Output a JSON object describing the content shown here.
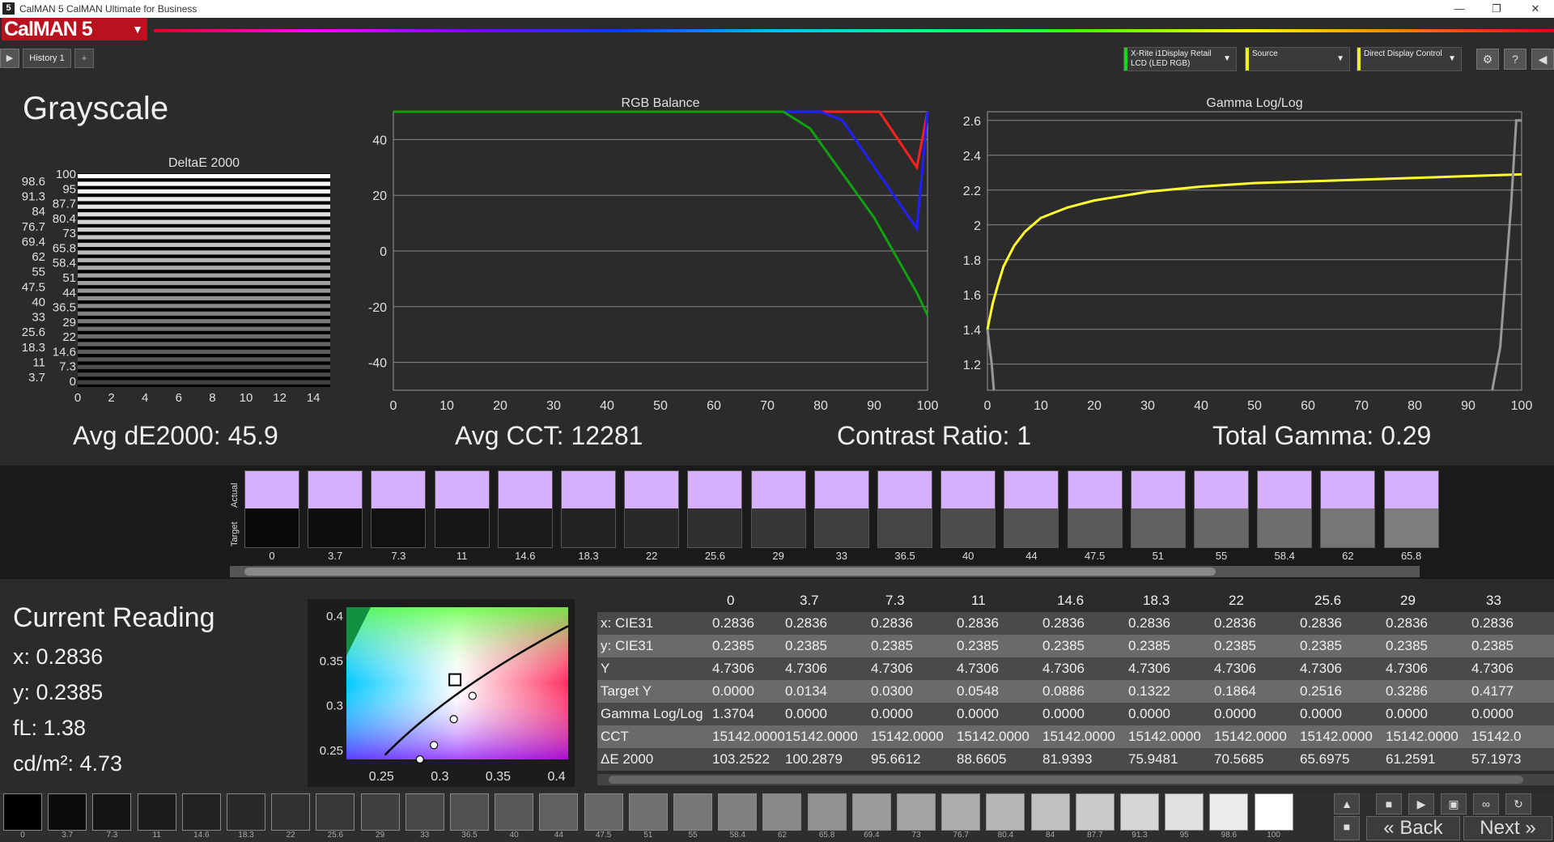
{
  "window": {
    "title": "CalMAN 5 CalMAN Ultimate for Business",
    "app_icon": "5",
    "minimize": "—",
    "restore": "❐",
    "close": "✕"
  },
  "header": {
    "logo": "CalMAN 5",
    "tab_label": "History 1",
    "tab_add": "+",
    "meter_line1": "X-Rite i1Display Retail",
    "meter_line2": "LCD (LED RGB)",
    "source_label": "Source",
    "display_label": "Direct Display Control"
  },
  "page": {
    "title": "Grayscale"
  },
  "stats": {
    "avg_de": "Avg dE2000: 45.9",
    "avg_cct": "Avg CCT: 12281",
    "contrast": "Contrast Ratio: 1",
    "total_gamma": "Total Gamma: 0.29"
  },
  "chart_data": [
    {
      "type": "bar",
      "title": "DeltaE 2000",
      "orientation": "horizontal",
      "xlim": [
        0,
        15
      ],
      "xticks": [
        0,
        2,
        4,
        6,
        8,
        10,
        12,
        14
      ],
      "categories_left": [
        "98.6",
        "91.3",
        "84",
        "76.7",
        "69.4",
        "62",
        "55",
        "47.5",
        "40",
        "33",
        "25.6",
        "18.3",
        "11",
        "3.7"
      ],
      "categories_right": [
        "100",
        "95",
        "87.7",
        "80.4",
        "73",
        "65.8",
        "58.4",
        "51",
        "44",
        "36.5",
        "29",
        "22",
        "14.6",
        "7.3",
        "0"
      ],
      "note_values_exceed_range": true
    },
    {
      "type": "line",
      "title": "RGB Balance",
      "xlim": [
        0,
        100
      ],
      "ylim": [
        -50,
        50
      ],
      "xticks": [
        0,
        10,
        20,
        30,
        40,
        50,
        60,
        70,
        80,
        90,
        100
      ],
      "yticks": [
        -40,
        -20,
        0,
        20,
        40
      ],
      "series": [
        {
          "color": "#ff2020",
          "x": [
            0,
            91,
            98,
            100
          ],
          "y": [
            50,
            50,
            30,
            50
          ]
        },
        {
          "color": "#2020ff",
          "x": [
            0,
            80,
            84,
            98,
            100
          ],
          "y": [
            50,
            50,
            47,
            8,
            50
          ]
        },
        {
          "color": "#10a010",
          "x": [
            0,
            73,
            78,
            90,
            98,
            100
          ],
          "y": [
            50,
            50,
            44,
            12,
            -15,
            -23
          ]
        }
      ]
    },
    {
      "type": "line",
      "title": "Gamma Log/Log",
      "xlim": [
        0,
        100
      ],
      "ylim": [
        1.05,
        2.65
      ],
      "xticks": [
        0,
        10,
        20,
        30,
        40,
        50,
        60,
        70,
        80,
        90,
        100
      ],
      "yticks": [
        1.2,
        1.4,
        1.6,
        1.8,
        2,
        2.2,
        2.4,
        2.6
      ],
      "series": [
        {
          "color": "#ffff30",
          "x": [
            0,
            1,
            2,
            3,
            5,
            7,
            10,
            15,
            20,
            30,
            40,
            50,
            60,
            70,
            80,
            90,
            100
          ],
          "y": [
            1.4,
            1.55,
            1.66,
            1.76,
            1.88,
            1.96,
            2.04,
            2.1,
            2.14,
            2.19,
            2.22,
            2.24,
            2.25,
            2.26,
            2.27,
            2.28,
            2.29
          ]
        },
        {
          "color": "#999999",
          "x": [
            0,
            0.8,
            1.2
          ],
          "y": [
            1.4,
            1.2,
            1.05
          ]
        },
        {
          "color": "#999999",
          "x": [
            94.5,
            96,
            98,
            99,
            100
          ],
          "y": [
            1.05,
            1.3,
            2.1,
            2.6,
            2.6
          ]
        }
      ]
    },
    {
      "type": "scatter",
      "title": "CIE 1931",
      "xlim": [
        0.22,
        0.41
      ],
      "ylim": [
        0.24,
        0.41
      ],
      "xticks": [
        0.25,
        0.3,
        0.35,
        0.4
      ],
      "yticks": [
        0.25,
        0.3,
        0.35,
        0.4
      ],
      "target": {
        "x": 0.313,
        "y": 0.329
      },
      "points": [
        {
          "x": 0.283,
          "y": 0.24
        },
        {
          "x": 0.295,
          "y": 0.256
        },
        {
          "x": 0.312,
          "y": 0.285
        },
        {
          "x": 0.328,
          "y": 0.311
        }
      ]
    }
  ],
  "swatches": {
    "actual_label": "Actual",
    "target_label": "Target",
    "items": [
      {
        "label": "0",
        "target": "#0a0a0a"
      },
      {
        "label": "3.7",
        "target": "#0d0d0d"
      },
      {
        "label": "7.3",
        "target": "#111111"
      },
      {
        "label": "11",
        "target": "#161616"
      },
      {
        "label": "14.6",
        "target": "#1c1c1c"
      },
      {
        "label": "18.3",
        "target": "#222222"
      },
      {
        "label": "22",
        "target": "#292929"
      },
      {
        "label": "25.6",
        "target": "#303030"
      },
      {
        "label": "29",
        "target": "#373737"
      },
      {
        "label": "33",
        "target": "#3e3e3e"
      },
      {
        "label": "36.5",
        "target": "#454545"
      },
      {
        "label": "40",
        "target": "#4c4c4c"
      },
      {
        "label": "44",
        "target": "#535353"
      },
      {
        "label": "47.5",
        "target": "#5a5a5a"
      },
      {
        "label": "51",
        "target": "#616161"
      },
      {
        "label": "55",
        "target": "#686868"
      },
      {
        "label": "58.4",
        "target": "#6f6f6f"
      },
      {
        "label": "62",
        "target": "#767676"
      },
      {
        "label": "65.8",
        "target": "#7d7d7d"
      }
    ]
  },
  "current_reading": {
    "title": "Current Reading",
    "x": "x: 0.2836",
    "y": "y: 0.2385",
    "fl": "fL: 1.38",
    "cdm2": "cd/m²: 4.73"
  },
  "table": {
    "columns": [
      "0",
      "3.7",
      "7.3",
      "11",
      "14.6",
      "18.3",
      "22",
      "25.6",
      "29",
      "33"
    ],
    "rows": [
      {
        "label": "x: CIE31",
        "values": [
          "0.2836",
          "0.2836",
          "0.2836",
          "0.2836",
          "0.2836",
          "0.2836",
          "0.2836",
          "0.2836",
          "0.2836",
          "0.2836"
        ]
      },
      {
        "label": "y: CIE31",
        "values": [
          "0.2385",
          "0.2385",
          "0.2385",
          "0.2385",
          "0.2385",
          "0.2385",
          "0.2385",
          "0.2385",
          "0.2385",
          "0.2385"
        ]
      },
      {
        "label": "Y",
        "values": [
          "4.7306",
          "4.7306",
          "4.7306",
          "4.7306",
          "4.7306",
          "4.7306",
          "4.7306",
          "4.7306",
          "4.7306",
          "4.7306"
        ]
      },
      {
        "label": "Target Y",
        "values": [
          "0.0000",
          "0.0134",
          "0.0300",
          "0.0548",
          "0.0886",
          "0.1322",
          "0.1864",
          "0.2516",
          "0.3286",
          "0.4177"
        ]
      },
      {
        "label": "Gamma Log/Log",
        "values": [
          "1.3704",
          "0.0000",
          "0.0000",
          "0.0000",
          "0.0000",
          "0.0000",
          "0.0000",
          "0.0000",
          "0.0000",
          "0.0000"
        ]
      },
      {
        "label": "CCT",
        "values": [
          "15142.0000",
          "15142.0000",
          "15142.0000",
          "15142.0000",
          "15142.0000",
          "15142.0000",
          "15142.0000",
          "15142.0000",
          "15142.0000",
          "15142.0"
        ]
      },
      {
        "label": "ΔE 2000",
        "values": [
          "103.2522",
          "100.2879",
          "95.6612",
          "88.6605",
          "81.9393",
          "75.9481",
          "70.5685",
          "65.6975",
          "61.2591",
          "57.1973"
        ]
      }
    ]
  },
  "patches": [
    {
      "label": "0",
      "color": "#000000"
    },
    {
      "label": "3.7",
      "color": "#0c0c0c"
    },
    {
      "label": "7.3",
      "color": "#141414"
    },
    {
      "label": "11",
      "color": "#1b1b1b"
    },
    {
      "label": "14.6",
      "color": "#222222"
    },
    {
      "label": "18.3",
      "color": "#292929"
    },
    {
      "label": "22",
      "color": "#313131"
    },
    {
      "label": "25.6",
      "color": "#383838"
    },
    {
      "label": "29",
      "color": "#404040"
    },
    {
      "label": "33",
      "color": "#484848"
    },
    {
      "label": "36.5",
      "color": "#505050"
    },
    {
      "label": "40",
      "color": "#585858"
    },
    {
      "label": "44",
      "color": "#606060"
    },
    {
      "label": "47.5",
      "color": "#686868"
    },
    {
      "label": "51",
      "color": "#707070"
    },
    {
      "label": "55",
      "color": "#787878"
    },
    {
      "label": "58.4",
      "color": "#818181"
    },
    {
      "label": "62",
      "color": "#898989"
    },
    {
      "label": "65.8",
      "color": "#929292"
    },
    {
      "label": "69.4",
      "color": "#9b9b9b"
    },
    {
      "label": "73",
      "color": "#a4a4a4"
    },
    {
      "label": "76.7",
      "color": "#adadad"
    },
    {
      "label": "80.4",
      "color": "#b7b7b7"
    },
    {
      "label": "84",
      "color": "#c1c1c1"
    },
    {
      "label": "87.7",
      "color": "#cbcbcb"
    },
    {
      "label": "91.3",
      "color": "#d5d5d5"
    },
    {
      "label": "95",
      "color": "#e0e0e0"
    },
    {
      "label": "98.6",
      "color": "#ebebeb"
    },
    {
      "label": "100",
      "color": "#ffffff"
    }
  ],
  "nav": {
    "back": "Back",
    "next": "Next"
  }
}
